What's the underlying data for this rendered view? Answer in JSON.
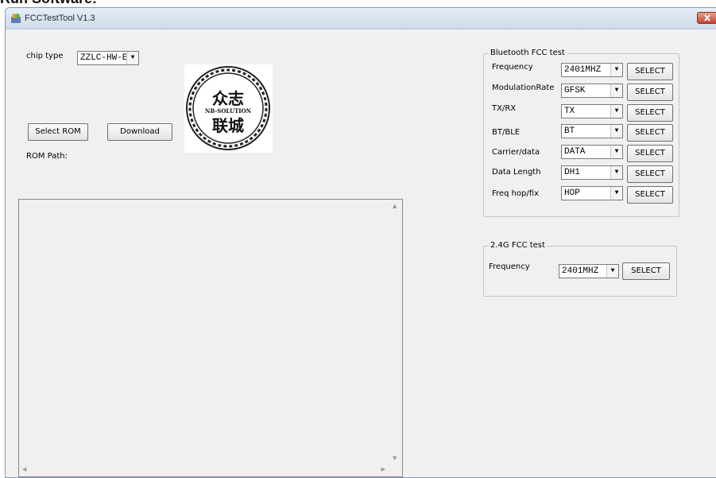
{
  "heading": "Run Software:",
  "window": {
    "title": "FCCTestTool V1.3"
  },
  "chip": {
    "label": "chip type",
    "value": "ZZLC-HW-E"
  },
  "buttons": {
    "select_rom": "Select ROM",
    "download": "Download"
  },
  "rom_path_label": "ROM Path:",
  "logo": {
    "line1": "众志",
    "line2": "NB-SOLUTION",
    "line3": "联城"
  },
  "bt": {
    "title": "Bluetooth FCC test",
    "rows": [
      {
        "label": "Frequency",
        "value": "2401MHZ",
        "button": "SELECT"
      },
      {
        "label": "ModulationRate",
        "value": "GFSK",
        "button": "SELECT"
      },
      {
        "label": "TX/RX",
        "value": "TX",
        "button": "SELECT"
      },
      {
        "label": "BT/BLE",
        "value": "BT",
        "button": "SELECT"
      },
      {
        "label": "Carrier/data",
        "value": "DATA",
        "button": "SELECT"
      },
      {
        "label": "Data Length",
        "value": "DH1",
        "button": "SELECT"
      },
      {
        "label": "Freq hop/fix",
        "value": "HOP",
        "button": "SELECT"
      }
    ]
  },
  "g24": {
    "title": "2.4G FCC test",
    "frequency": {
      "label": "Frequency",
      "value": "2401MHZ",
      "button": "SELECT"
    }
  },
  "icons": {
    "app": "app-icon",
    "close": "close-icon",
    "dropdown": "chevron-down-icon"
  }
}
